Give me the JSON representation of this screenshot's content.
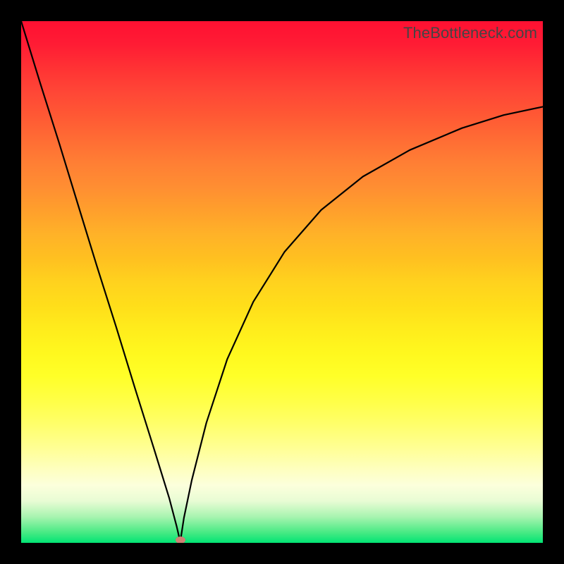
{
  "watermark": "TheBottleneck.com",
  "colors": {
    "background_frame": "#000000",
    "curve": "#000000",
    "marker": "#ce8274",
    "gradient_stops": [
      {
        "pos": 0.0,
        "rgb": [
          255,
          16,
          50
        ]
      },
      {
        "pos": 0.25,
        "rgb": [
          255,
          130,
          52
        ]
      },
      {
        "pos": 0.5,
        "rgb": [
          255,
          210,
          30
        ]
      },
      {
        "pos": 0.75,
        "rgb": [
          255,
          255,
          120
        ]
      },
      {
        "pos": 0.98,
        "rgb": [
          72,
          234,
          132
        ]
      },
      {
        "pos": 1.0,
        "rgb": [
          2,
          228,
          116
        ]
      }
    ]
  },
  "chart_data": {
    "type": "line",
    "title": "",
    "xlabel": "",
    "ylabel": "",
    "xlim": [
      0,
      1
    ],
    "ylim": [
      0,
      1
    ],
    "x_min_at_zero": 0.305,
    "marker": {
      "x": 0.306,
      "y": 0.006
    },
    "series": [
      {
        "name": "left-branch",
        "x": [
          0.0,
          0.036,
          0.073,
          0.109,
          0.145,
          0.182,
          0.218,
          0.255,
          0.284,
          0.298,
          0.305
        ],
        "y": [
          1.0,
          0.883,
          0.766,
          0.648,
          0.531,
          0.414,
          0.297,
          0.179,
          0.085,
          0.032,
          0.002
        ]
      },
      {
        "name": "right-branch",
        "x": [
          0.305,
          0.312,
          0.327,
          0.355,
          0.395,
          0.445,
          0.505,
          0.575,
          0.655,
          0.745,
          0.845,
          0.925,
          1.0
        ],
        "y": [
          0.002,
          0.048,
          0.12,
          0.23,
          0.352,
          0.462,
          0.558,
          0.638,
          0.702,
          0.753,
          0.795,
          0.82,
          0.836
        ]
      }
    ]
  }
}
